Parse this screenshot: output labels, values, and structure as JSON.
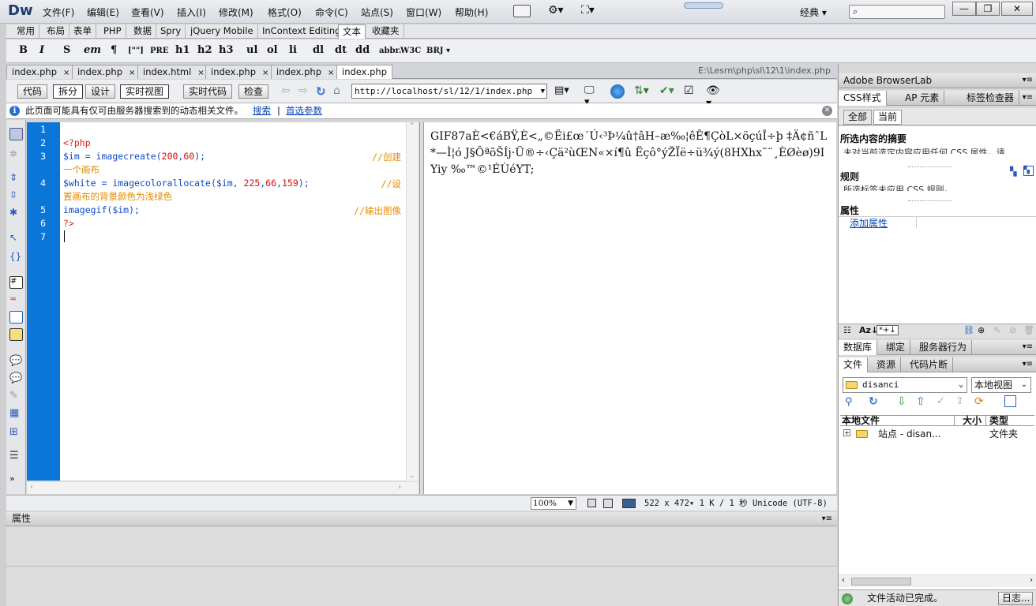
{
  "app": {
    "logo": "Dw",
    "workspace": "经典"
  },
  "menu": [
    "文件(F)",
    "编辑(E)",
    "查看(V)",
    "插入(I)",
    "修改(M)",
    "格式(O)",
    "命令(C)",
    "站点(S)",
    "窗口(W)",
    "帮助(H)"
  ],
  "insert_tabs": [
    "常用",
    "布局",
    "表单",
    "PHP",
    "数据",
    "Spry",
    "jQuery Mobile",
    "InContext Editing",
    "文本",
    "收藏夹"
  ],
  "insert_active": "文本",
  "format_buttons": [
    "B",
    "I",
    "S",
    "em",
    "¶",
    "[\"\"]",
    "PRE",
    "h1",
    "h2",
    "h3",
    "ul",
    "ol",
    "li",
    "dl",
    "dt",
    "dd",
    "abbr.",
    "W3C",
    "BRJ"
  ],
  "doc_tabs": [
    "index.php",
    "index.php",
    "index.html",
    "index.php",
    "index.php",
    "index.php"
  ],
  "doc_path": "E:\\Lesrn\\php\\sl\\12\\1\\index.php",
  "view_buttons": [
    "代码",
    "拆分",
    "设计",
    "实时视图",
    "实时代码",
    "检查"
  ],
  "url": "http://localhost/sl/12/1/index.php",
  "info": {
    "text": "此页面可能具有仅可由服务器搜索到的动态相关文件。",
    "link1": "搜索",
    "link2": "首选参数"
  },
  "code_lines": [
    {
      "n": "1",
      "parts": []
    },
    {
      "n": "2",
      "parts": [
        {
          "c": "kw",
          "t": "<?php"
        }
      ]
    },
    {
      "n": "3",
      "parts": [
        {
          "c": "var",
          "t": "$im"
        },
        {
          "c": "plain",
          "t": " = imagecreate("
        },
        {
          "c": "num",
          "t": "200"
        },
        {
          "c": "plain",
          "t": ","
        },
        {
          "c": "num",
          "t": "60"
        },
        {
          "c": "plain",
          "t": ");"
        }
      ],
      "comment": "//创建",
      "comment2": "一个画布"
    },
    {
      "n": "4",
      "parts": [
        {
          "c": "var",
          "t": "$white"
        },
        {
          "c": "plain",
          "t": " = imagecolorallocate("
        },
        {
          "c": "var",
          "t": "$im"
        },
        {
          "c": "plain",
          "t": ", "
        },
        {
          "c": "num",
          "t": "225"
        },
        {
          "c": "plain",
          "t": ","
        },
        {
          "c": "num",
          "t": "66"
        },
        {
          "c": "plain",
          "t": ","
        },
        {
          "c": "num",
          "t": "159"
        },
        {
          "c": "plain",
          "t": ");"
        }
      ],
      "comment": "//设",
      "comment2": "置画布的背景颜色为浅绿色"
    },
    {
      "n": "5",
      "parts": [
        {
          "c": "fn",
          "t": "imagegif("
        },
        {
          "c": "var",
          "t": "$im"
        },
        {
          "c": "plain",
          "t": ");"
        }
      ],
      "comment": "//输出图像"
    },
    {
      "n": "6",
      "parts": [
        {
          "c": "kw",
          "t": "?>"
        }
      ]
    },
    {
      "n": "7",
      "parts": []
    }
  ],
  "preview_text": "GIF87aÈ<€áBŸ,È<„©Ëi£œ´Ú‹³Þ¼û†âH–æ‰¦êÊ¶ÇòL×öçúÎ÷þ ‡Ä¢ñˆL*—Ì¦ó J§ÔªõŠÍj·Ü®÷‹Çä²ùŒN«×í¶û Ëçô°ýŽÏë÷ü¾ý(8HXhx˜¨¸ÈØèø)9IYiy ‰™©¹ÉÙéYT;",
  "status": {
    "zoom": "100%",
    "size": "522 x 472",
    "speed": "1 K / 1 秒",
    "encoding": "Unicode (UTF-8)"
  },
  "properties_label": "属性",
  "right": {
    "browserlab": "Adobe BrowserLab",
    "css_tabs": [
      "CSS样式",
      "AP 元素",
      "标签检查器"
    ],
    "mode_tabs": [
      "全部",
      "当前"
    ],
    "summary_title": "所选内容的摘要",
    "summary_sub": "未对当前选定内容应用任何 CSS 属性。请",
    "rules_title": "规则",
    "rules_sub": "所选标签未应用 CSS 规则。",
    "attr_title": "属性",
    "add_attr": "添加属性",
    "db_tabs": [
      "数据库",
      "绑定",
      "服务器行为"
    ],
    "file_tabs": [
      "文件",
      "资源",
      "代码片断"
    ],
    "site": "disanci",
    "view": "本地视图",
    "col_local": "本地文件",
    "col_size": "大小",
    "col_type": "类型",
    "file_name": "站点 - disan...",
    "file_type": "文件夹",
    "file_status": "文件活动已完成。",
    "log_button": "日志..."
  }
}
